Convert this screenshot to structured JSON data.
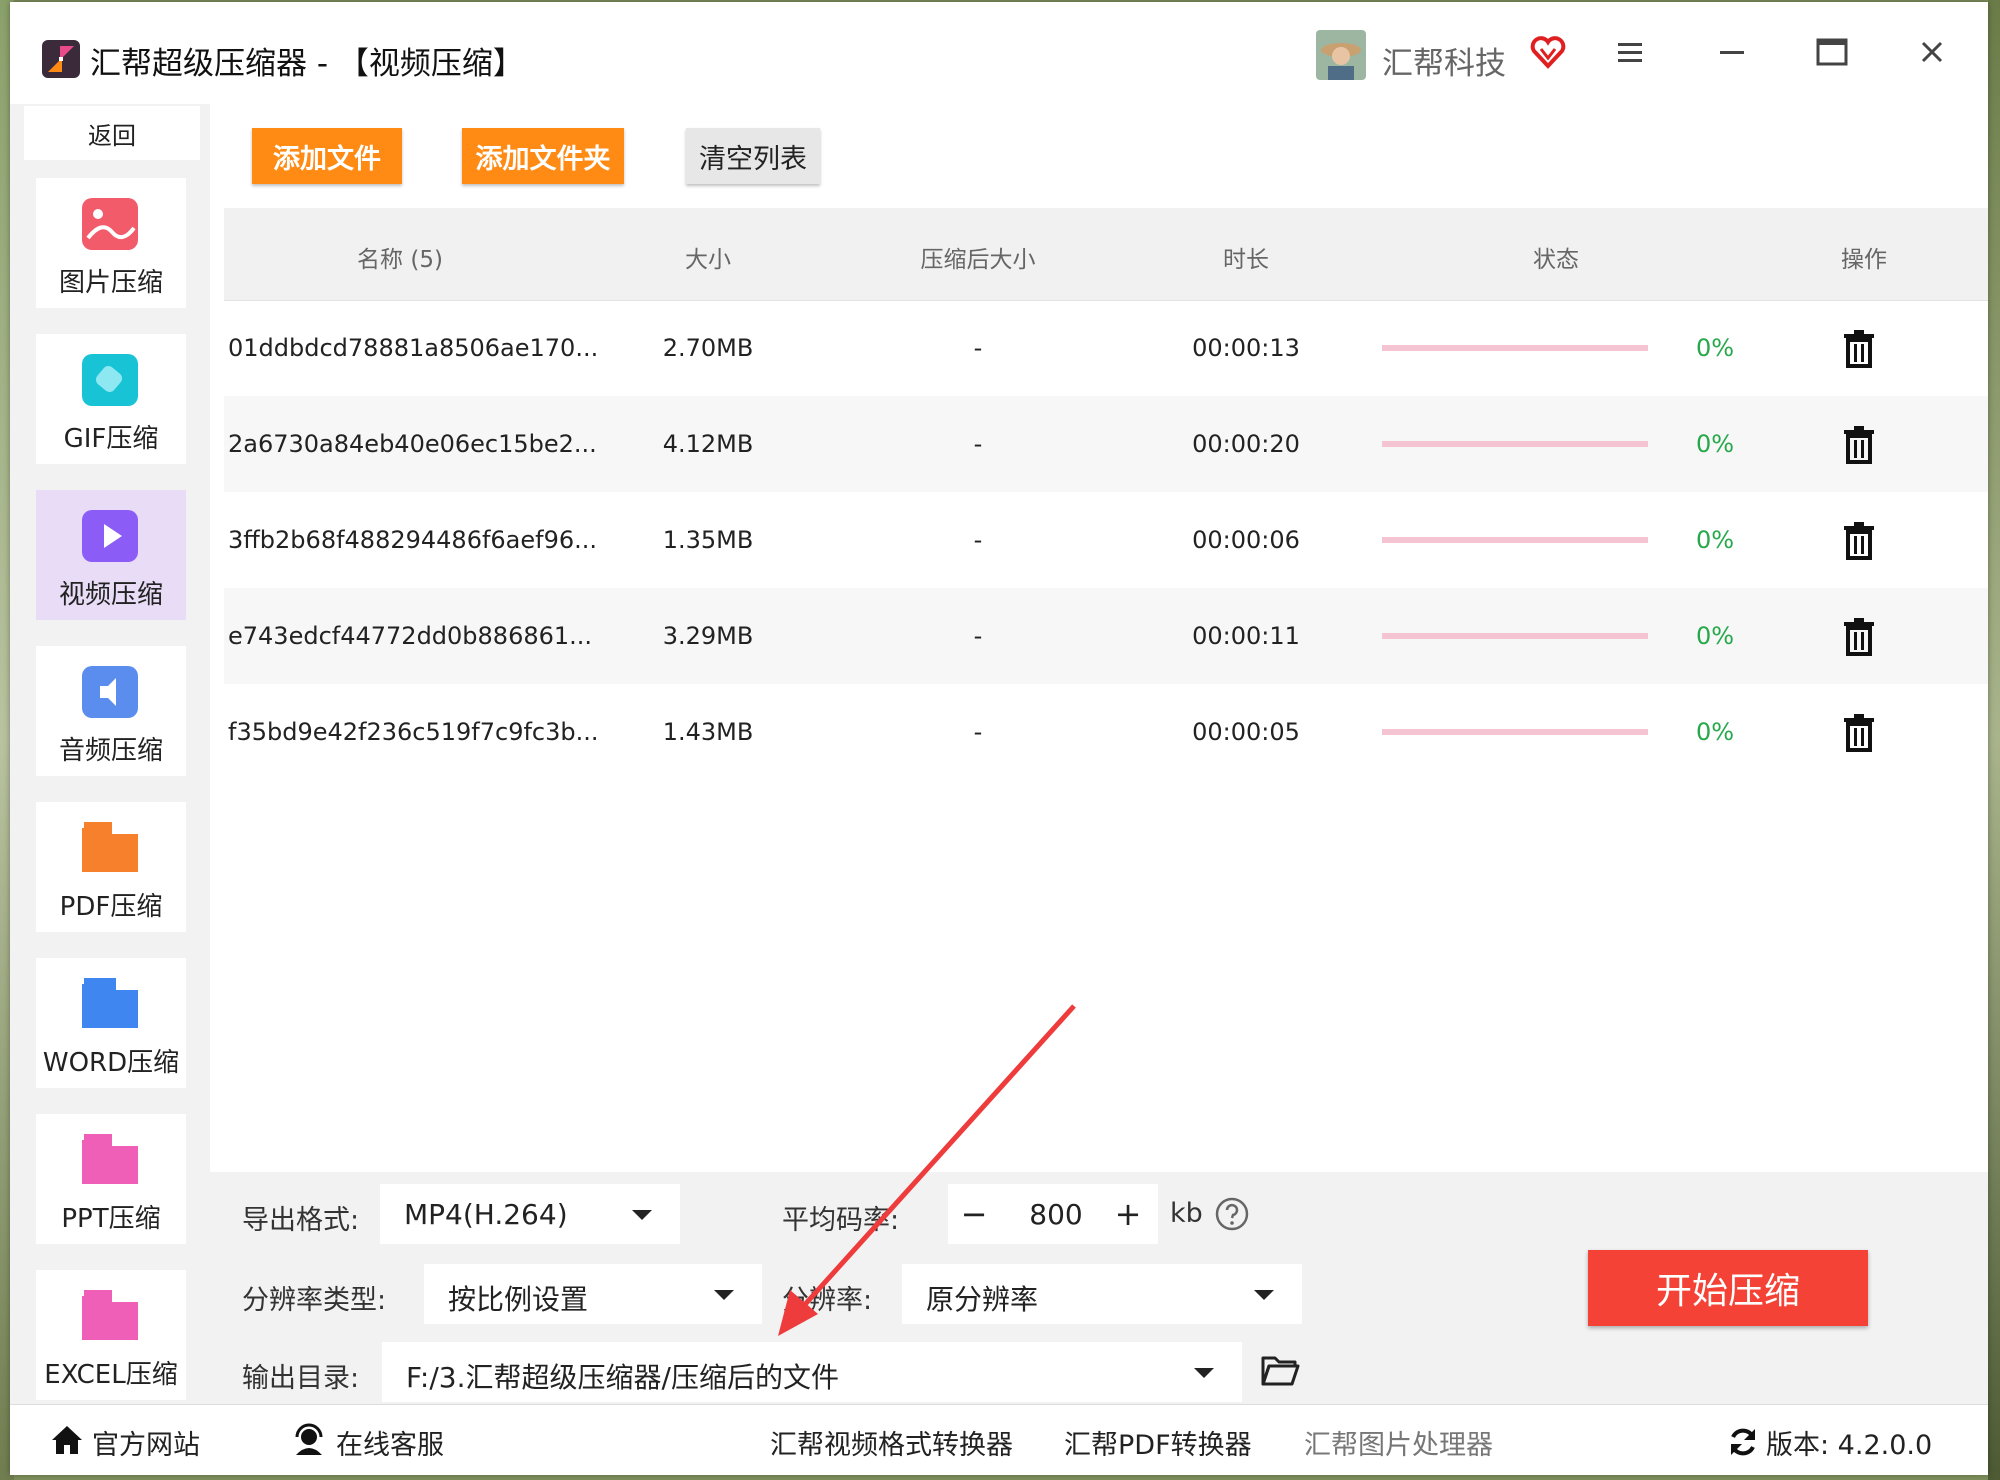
{
  "window": {
    "title": "汇帮超级压缩器 - 【视频压缩】",
    "user_name": "汇帮科技"
  },
  "sidebar": {
    "back_label": "返回",
    "items": [
      {
        "label": "图片压缩",
        "icon": "image-icon",
        "color": "#f25b6a"
      },
      {
        "label": "GIF压缩",
        "icon": "gif-icon",
        "color": "#19c3d6"
      },
      {
        "label": "视频压缩",
        "icon": "video-play-icon",
        "color": "#8b5cf6",
        "active": true
      },
      {
        "label": "音频压缩",
        "icon": "audio-icon",
        "color": "#5b8def"
      },
      {
        "label": "PDF压缩",
        "icon": "pdf-icon",
        "color": "#f7802d"
      },
      {
        "label": "WORD压缩",
        "icon": "word-icon",
        "color": "#3f86f0"
      },
      {
        "label": "PPT压缩",
        "icon": "ppt-icon",
        "color": "#ef5fb8"
      },
      {
        "label": "EXCEL压缩",
        "icon": "excel-icon",
        "color": "#ef5fb8"
      }
    ]
  },
  "toolbar": {
    "add_file": "添加文件",
    "add_folder": "添加文件夹",
    "clear_list": "清空列表"
  },
  "table": {
    "headers": [
      "名称 (5)",
      "大小",
      "压缩后大小",
      "时长",
      "状态",
      "操作"
    ],
    "rows": [
      {
        "name": "01ddbdcd78881a8506ae170...",
        "size": "2.70MB",
        "compressed": "-",
        "duration": "00:00:13",
        "progress": "0%"
      },
      {
        "name": "2a6730a84eb40e06ec15be2...",
        "size": "4.12MB",
        "compressed": "-",
        "duration": "00:00:20",
        "progress": "0%"
      },
      {
        "name": "3ffb2b68f488294486f6aef96...",
        "size": "1.35MB",
        "compressed": "-",
        "duration": "00:00:06",
        "progress": "0%"
      },
      {
        "name": "e743edcf44772dd0b886861...",
        "size": "3.29MB",
        "compressed": "-",
        "duration": "00:00:11",
        "progress": "0%"
      },
      {
        "name": "f35bd9e42f236c519f7c9fc3b...",
        "size": "1.43MB",
        "compressed": "-",
        "duration": "00:00:05",
        "progress": "0%"
      }
    ]
  },
  "settings": {
    "format_label": "导出格式:",
    "format_value": "MP4(H.264)",
    "bitrate_label": "平均码率:",
    "bitrate_value": "800",
    "bitrate_unit": "kb",
    "res_type_label": "分辨率类型:",
    "res_type_value": "按比例设置",
    "res_label": "分辨率:",
    "res_value": "原分辨率",
    "output_label": "输出目录:",
    "output_value": "F:/3.汇帮超级压缩器/压缩后的文件",
    "start_button": "开始压缩"
  },
  "footer": {
    "website": "官方网站",
    "support": "在线客服",
    "link1": "汇帮视频格式转换器",
    "link2": "汇帮PDF转换器",
    "link3": "汇帮图片处理器",
    "version": "版本:  4.2.0.0"
  },
  "colors": {
    "accent_orange": "#ff8a14",
    "start_red": "#f44336",
    "progress_pink": "#f5c4d2",
    "percent_green": "#27a84a",
    "active_nav": "#e8dcf6"
  }
}
